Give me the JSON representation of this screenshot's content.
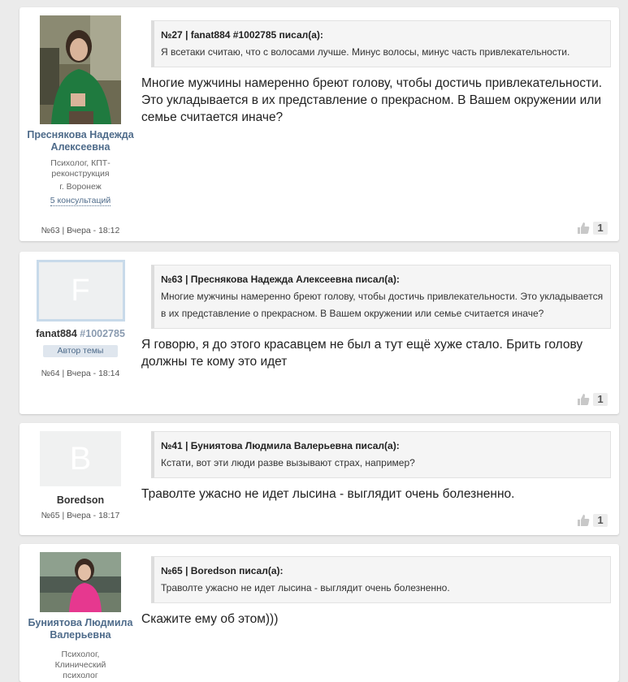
{
  "posts": [
    {
      "author": {
        "name": "Преснякова Надежда Алексеевна",
        "role": "Психолог, КПТ-реконструкция",
        "city": "г. Воронеж",
        "consultations": "5 консультаций"
      },
      "meta": "№63 | Вчера - 18:12",
      "quote": {
        "number": "№27",
        "header": "fanat884 #1002785 писал(а):",
        "text": "Я всетаки считаю, что с волосами лучше. Минус волосы, минус часть привлекательности."
      },
      "text": "Многие мужчины намеренно бреют голову, чтобы достичь привлекательности. Это укладывается в их представление о прекрасном. В Вашем окружении или семье считается иначе?",
      "likes": "1"
    },
    {
      "author": {
        "avatar_letter": "F",
        "name": "fanat884",
        "uid": "#1002785",
        "badge": "Автор темы"
      },
      "meta": "№64 | Вчера - 18:14",
      "quote": {
        "number": "№63",
        "header": "Преснякова Надежда Алексеевна писал(а):",
        "text": "Многие мужчины намеренно бреют голову, чтобы достичь привлекательности. Это укладывается в их представление о прекрасном. В Вашем окружении или семье считается иначе?"
      },
      "text": "Я говорю, я до этого красавцем не был а тут ещё хуже стало. Брить голову должны те кому это идет",
      "likes": "1"
    },
    {
      "author": {
        "avatar_letter": "B",
        "name": "Boredson"
      },
      "meta": "№65 | Вчера - 18:17",
      "quote": {
        "number": "№41",
        "header": "Буниятова Людмила Валерьевна писал(а):",
        "text": "Кстати, вот эти люди разве вызывают страх, например?"
      },
      "text": "Траволте ужасно не идет лысина - выглядит очень болезненно.",
      "likes": "1"
    },
    {
      "author": {
        "name": "Буниятова Людмила Валерьевна",
        "role": "Психолог, Клинический психолог"
      },
      "quote": {
        "number": "№65",
        "header": "Boredson писал(а):",
        "text": "Траволте ужасно не идет лысина - выглядит очень болезненно."
      },
      "text": "Скажите ему об этом)))"
    }
  ],
  "icons": {
    "like": "thumbs-up-icon"
  },
  "colors": {
    "link": "#4e6b8a",
    "background": "#ebebeb"
  }
}
